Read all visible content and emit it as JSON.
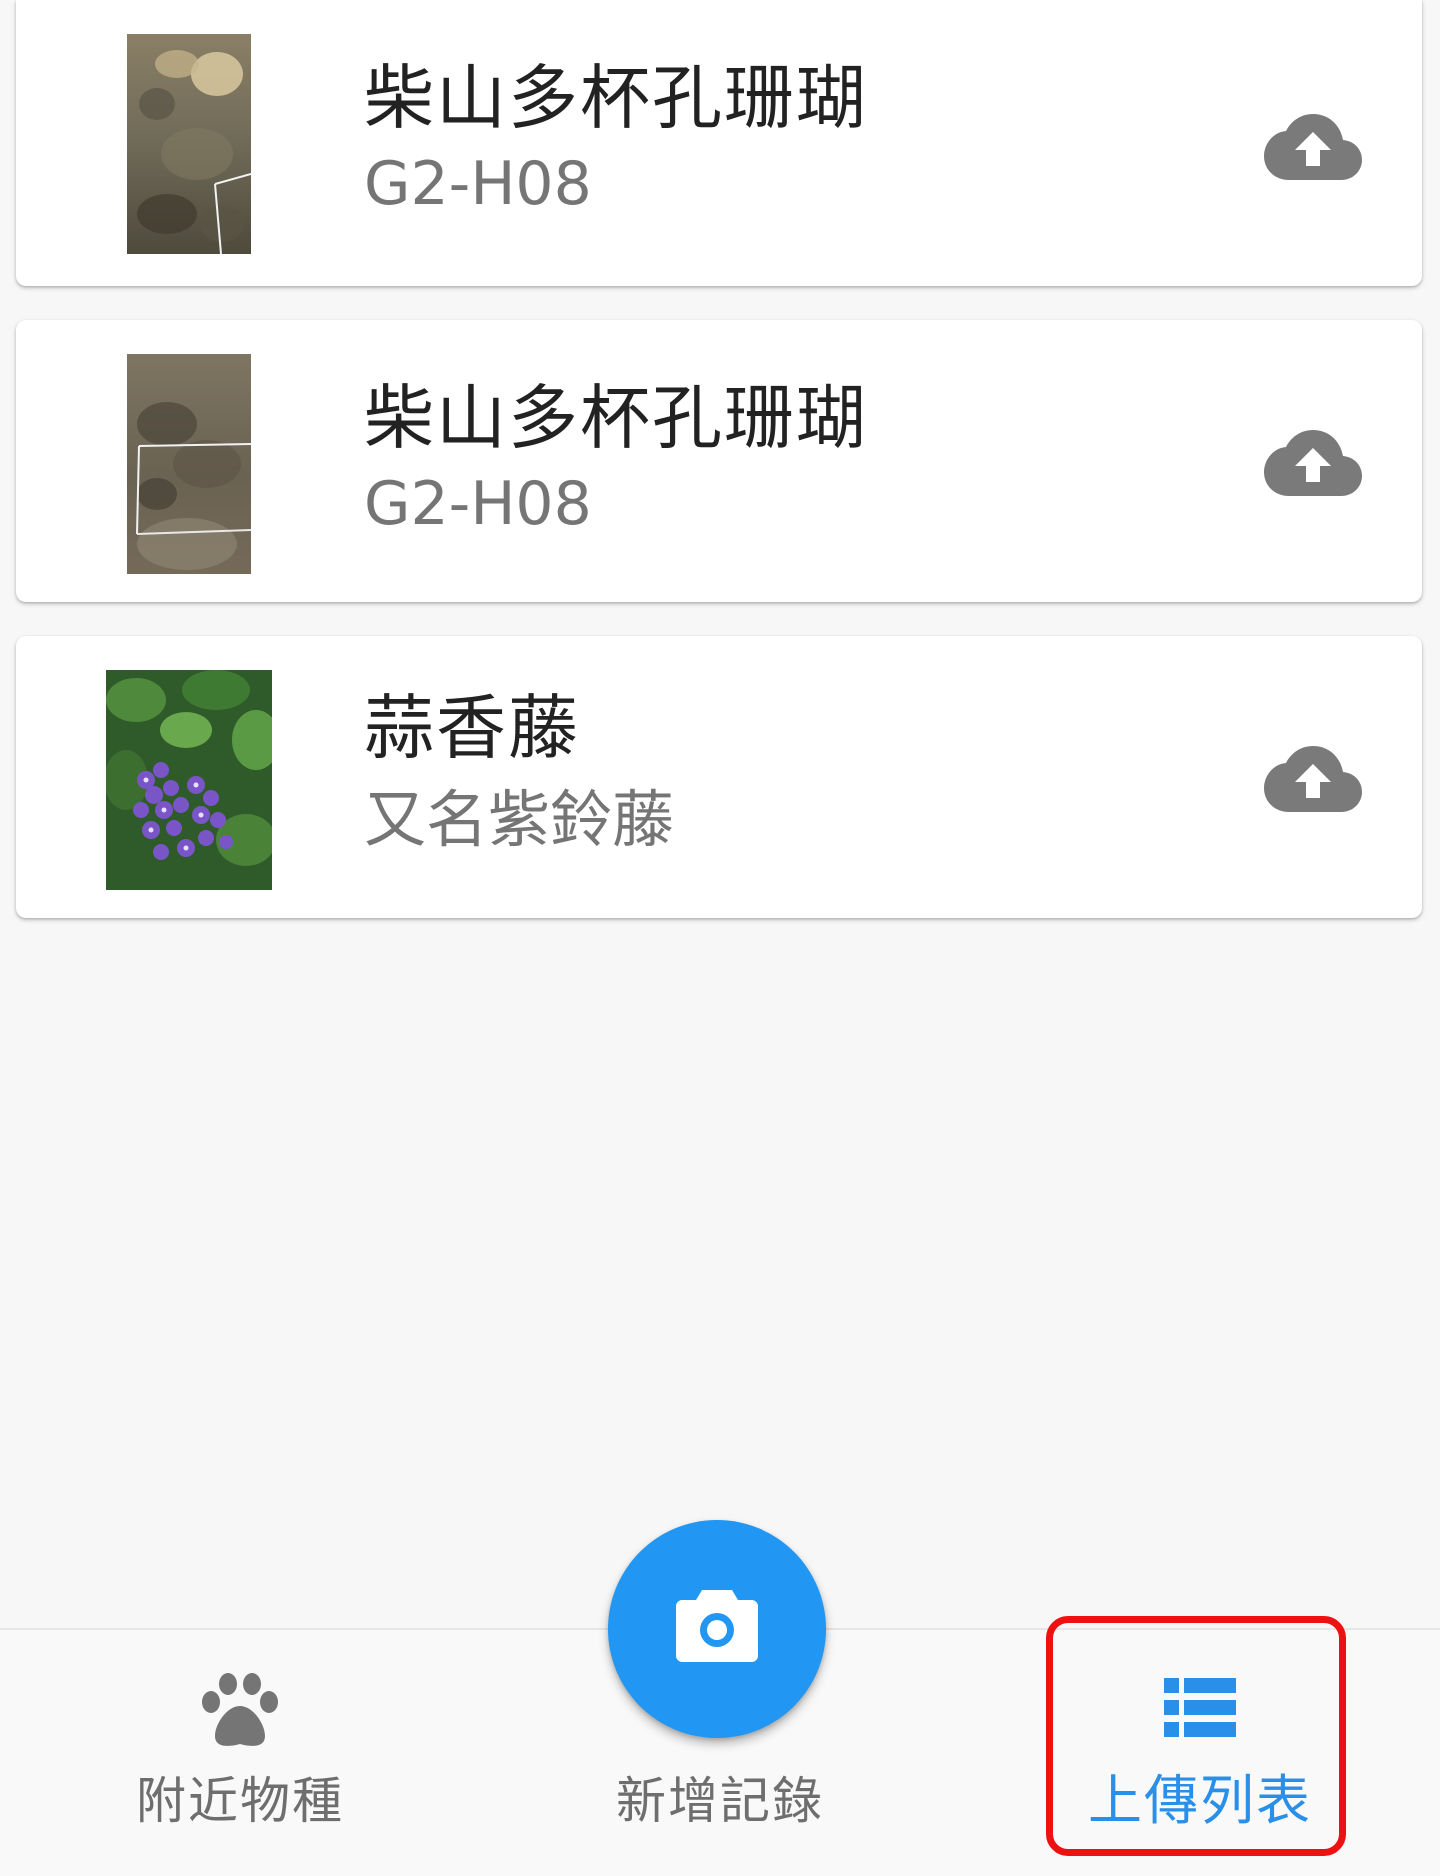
{
  "upload_list": {
    "items": [
      {
        "title": "柴山多杯孔珊瑚",
        "subtitle": "G2-H08",
        "thumbnail_icon": "coral-photo-thumbnail",
        "action_icon": "cloud-upload-icon"
      },
      {
        "title": "柴山多杯孔珊瑚",
        "subtitle": "G2-H08",
        "thumbnail_icon": "coral-photo-thumbnail",
        "action_icon": "cloud-upload-icon"
      },
      {
        "title": "蒜香藤",
        "subtitle": "又名紫鈴藤",
        "thumbnail_icon": "flower-photo-thumbnail",
        "action_icon": "cloud-upload-icon"
      }
    ]
  },
  "bottom_nav": {
    "items": [
      {
        "label": "附近物種",
        "icon": "paw-icon",
        "active": false
      },
      {
        "label": "新增記錄",
        "icon": "camera-icon",
        "active": false
      },
      {
        "label": "上傳列表",
        "icon": "list-icon",
        "active": true
      }
    ]
  },
  "colors": {
    "accent": "#2196f3",
    "active_label": "#2a8fe8",
    "inactive_label": "#6e6e6e",
    "upload_icon": "#757575",
    "highlight": "#ee1111"
  }
}
